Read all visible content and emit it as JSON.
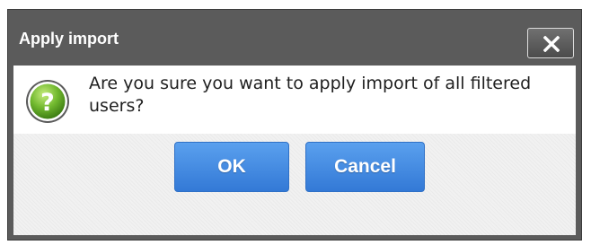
{
  "dialog": {
    "title": "Apply import",
    "close_icon": "close-icon",
    "question_icon": "question-icon",
    "message": "Are you sure you want to apply import of all filtered users?",
    "ok_label": "OK",
    "cancel_label": "Cancel"
  },
  "colors": {
    "titlebar": "#5b5b5b",
    "button_blue": "#3d86e0",
    "icon_green": "#6cb52d"
  }
}
